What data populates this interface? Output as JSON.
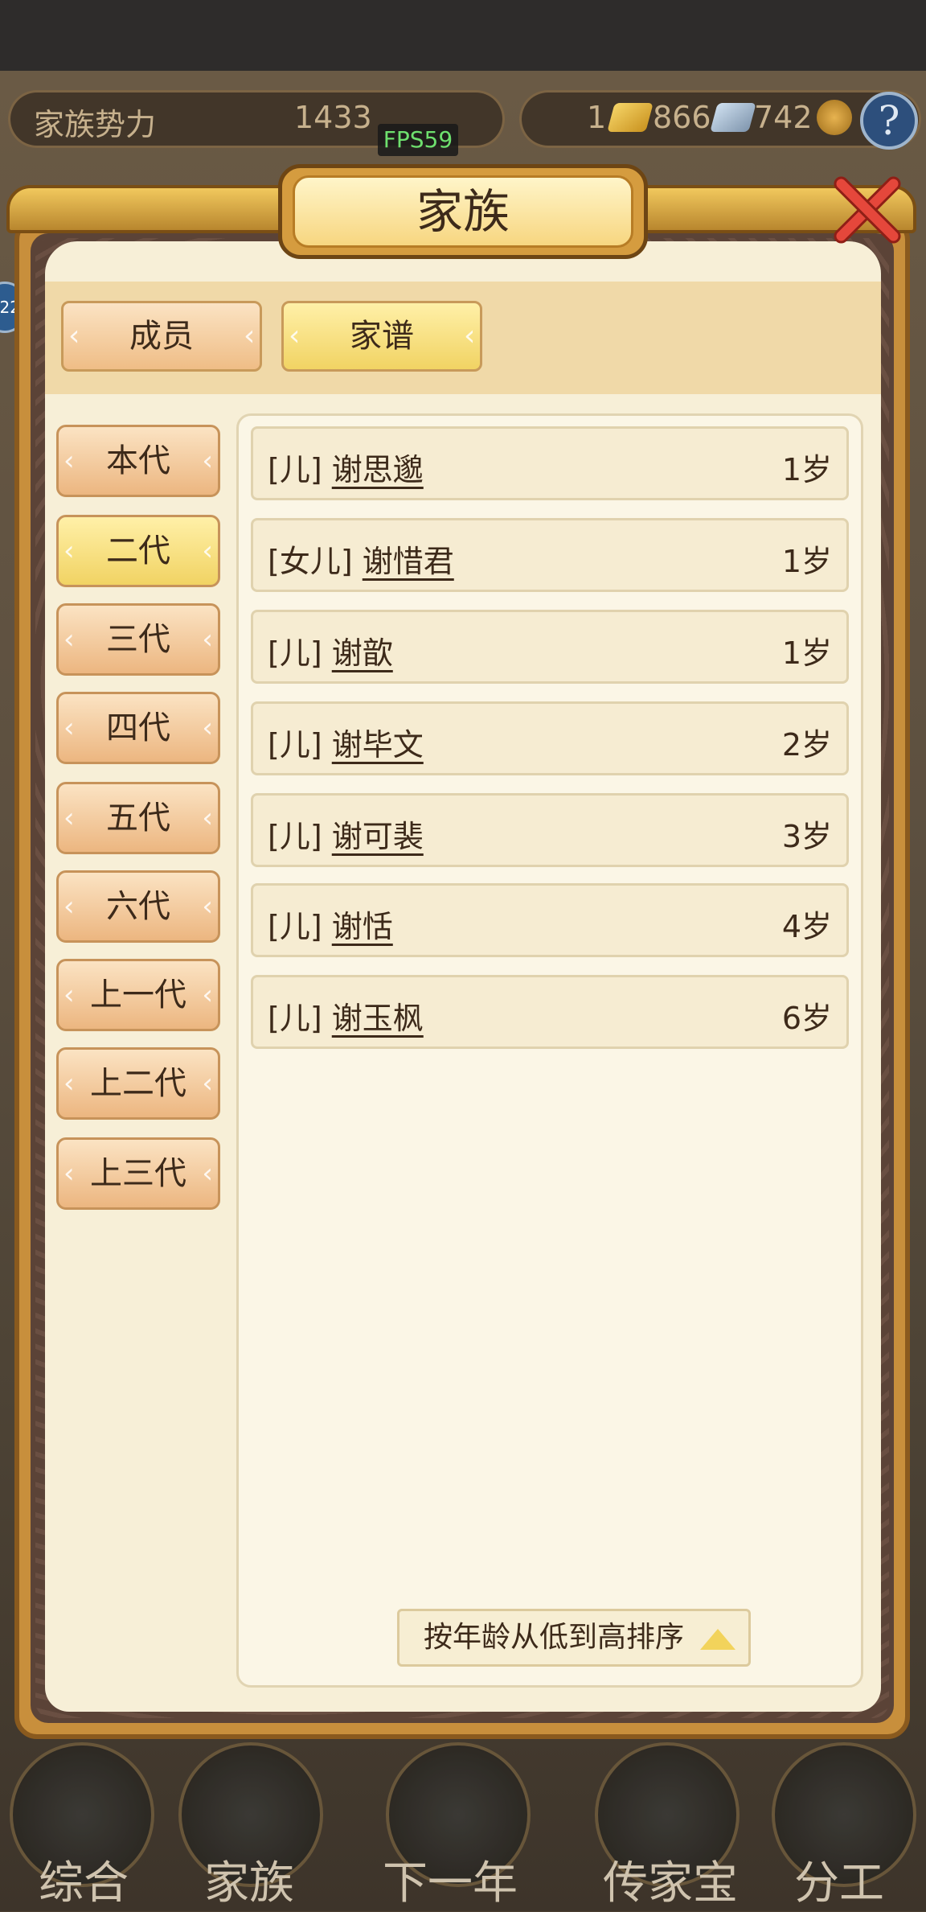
{
  "hud": {
    "clan_power_label": "家族势力",
    "clan_power_value": "1433",
    "gold_count_prefix": "1",
    "gold_count": "866",
    "silver_count": "742",
    "fps": "FPS59",
    "side_badge": "22"
  },
  "panel": {
    "title": "家族"
  },
  "tabs": [
    {
      "label": "成员",
      "active": false
    },
    {
      "label": "家谱",
      "active": true
    }
  ],
  "generations": [
    {
      "label": "本代",
      "active": false
    },
    {
      "label": "二代",
      "active": true
    },
    {
      "label": "三代",
      "active": false
    },
    {
      "label": "四代",
      "active": false
    },
    {
      "label": "五代",
      "active": false
    },
    {
      "label": "六代",
      "active": false
    },
    {
      "label": "上一代",
      "active": false
    },
    {
      "label": "上二代",
      "active": false
    },
    {
      "label": "上三代",
      "active": false
    }
  ],
  "members": [
    {
      "relation": "[儿]",
      "name": "谢思邈",
      "age": "1岁"
    },
    {
      "relation": "[女儿]",
      "name": "谢惜君",
      "age": "1岁"
    },
    {
      "relation": "[儿]",
      "name": "谢歆",
      "age": "1岁"
    },
    {
      "relation": "[儿]",
      "name": "谢毕文",
      "age": "2岁"
    },
    {
      "relation": "[儿]",
      "name": "谢可裴",
      "age": "3岁"
    },
    {
      "relation": "[儿]",
      "name": "谢恬",
      "age": "4岁"
    },
    {
      "relation": "[儿]",
      "name": "谢玉枫",
      "age": "6岁"
    }
  ],
  "sort": {
    "label": "按年龄从低到高排序",
    "icon": "triangle-up-icon"
  },
  "bottom_nav": [
    {
      "label": "综合",
      "icon": "scroll-icon"
    },
    {
      "label": "家族",
      "icon": "ancestral-hall-icon"
    },
    {
      "label": "下一年",
      "icon": "mountain-icon"
    },
    {
      "label": "传家宝",
      "icon": "jade-treasure-icon"
    },
    {
      "label": "分工",
      "icon": "people-icon"
    }
  ],
  "colors": {
    "panel_bg": "#f7efd7",
    "active_tab": "#f1d363",
    "inactive_tab": "#efbd86",
    "close": "#e5473b"
  }
}
